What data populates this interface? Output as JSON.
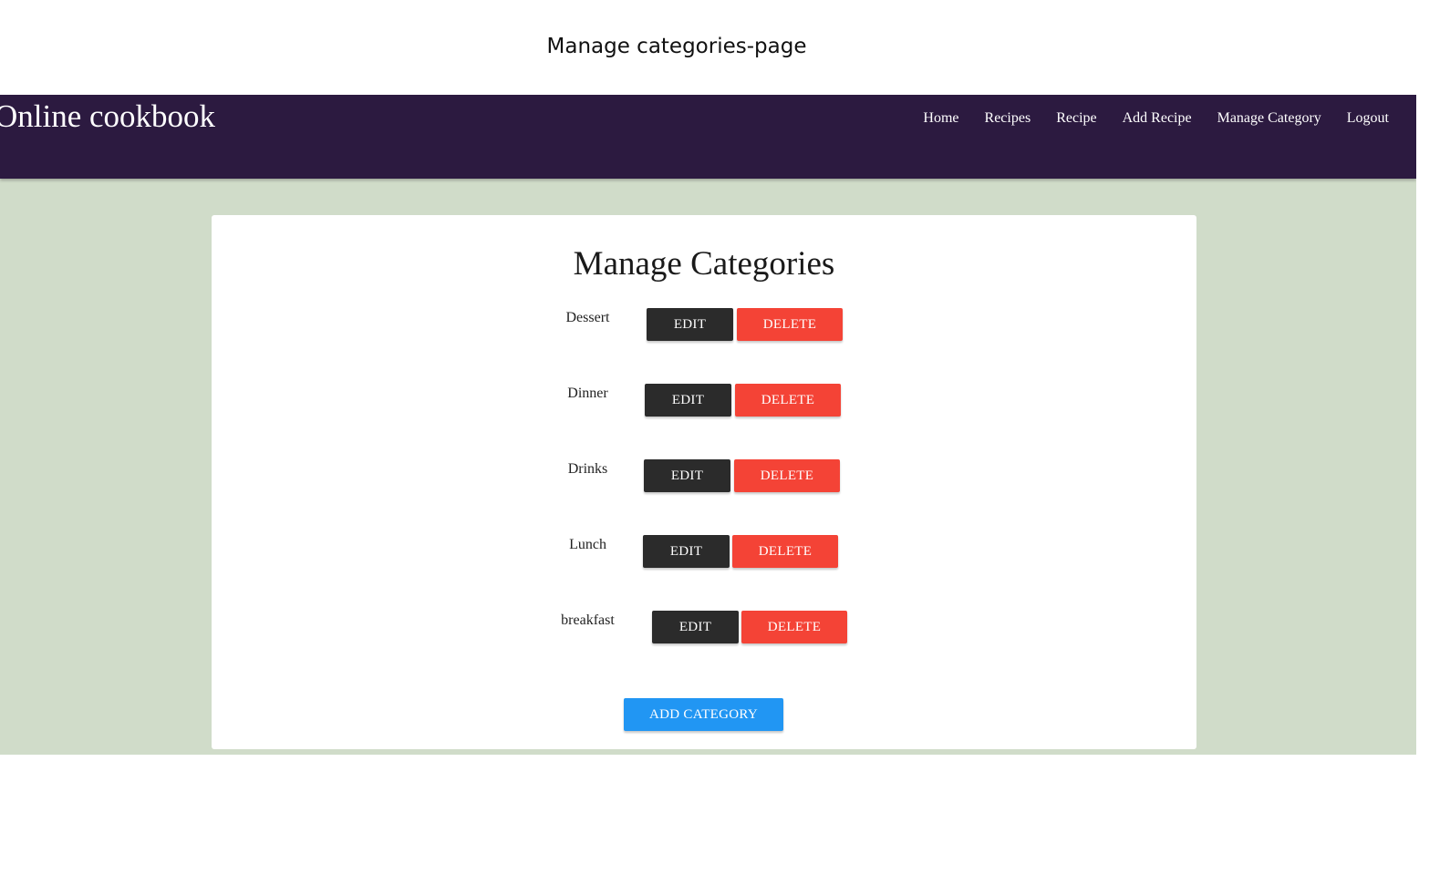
{
  "caption": "Manage categories-page",
  "navbar": {
    "brand": "Online cookbook",
    "links": [
      "Home",
      "Recipes",
      "Recipe",
      "Add Recipe",
      "Manage Category",
      "Logout"
    ]
  },
  "main": {
    "title": "Manage Categories",
    "categories": [
      {
        "name": "Dessert",
        "edit_label": "EDIT",
        "delete_label": "DELETE"
      },
      {
        "name": "Dinner",
        "edit_label": "EDIT",
        "delete_label": "DELETE"
      },
      {
        "name": "Drinks",
        "edit_label": "EDIT",
        "delete_label": "DELETE"
      },
      {
        "name": "Lunch",
        "edit_label": "EDIT",
        "delete_label": "DELETE"
      },
      {
        "name": "breakfast",
        "edit_label": "EDIT",
        "delete_label": "DELETE"
      }
    ],
    "add_label": "ADD CATEGORY"
  },
  "colors": {
    "navbar_bg": "#2c1a40",
    "page_bg": "#d0dcc9",
    "edit_button": "#2b2b2b",
    "delete_button": "#f44336",
    "add_button": "#2196f3"
  }
}
